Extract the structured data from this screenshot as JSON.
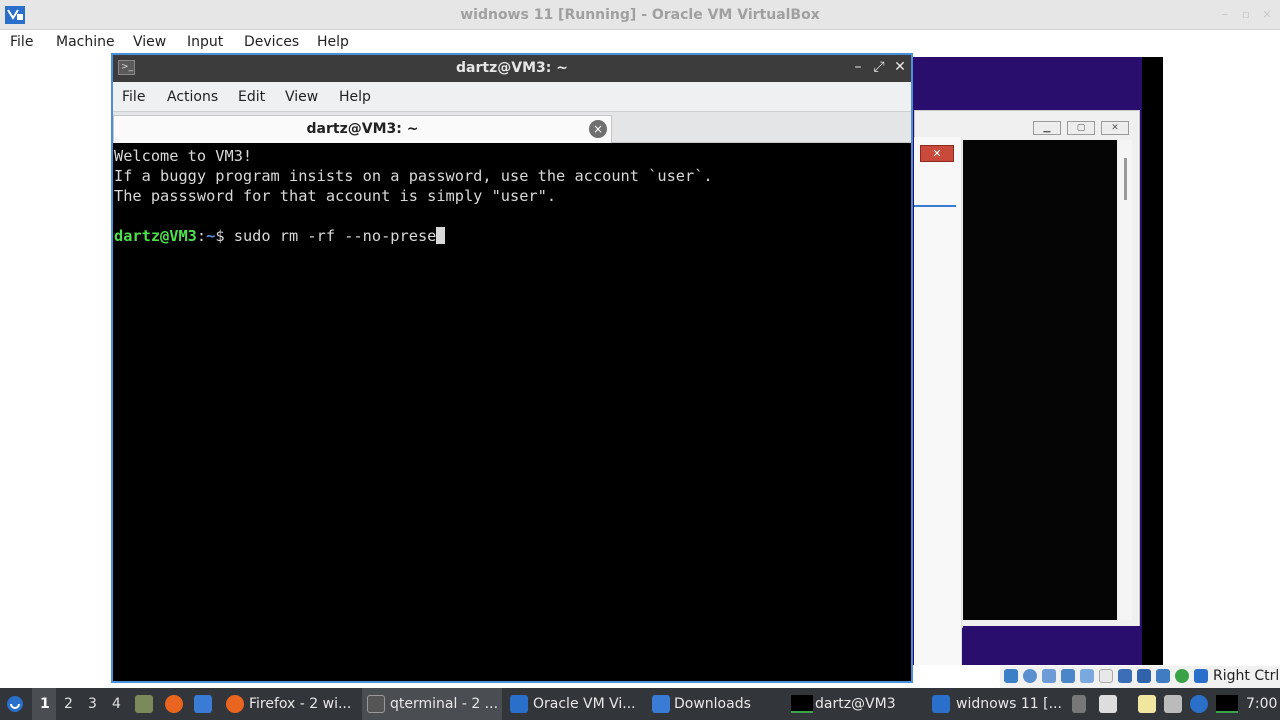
{
  "vbox": {
    "title": "widnows 11 [Running] - Oracle VM VirtualBox",
    "menu": [
      "File",
      "Machine",
      "View",
      "Input",
      "Devices",
      "Help"
    ],
    "host_key": "Right Ctrl"
  },
  "terminal": {
    "title": "dartz@VM3: ~",
    "menu": [
      "File",
      "Actions",
      "Edit",
      "View",
      "Help"
    ],
    "tab_label": "dartz@VM3: ~",
    "lines": [
      "Welcome to VM3!",
      "If a buggy program insists on a password, use the account `user`.",
      "The passsword for that account is simply \"user\"."
    ],
    "prompt_user": "dartz@VM3",
    "prompt_sep": ":",
    "prompt_path": "~",
    "prompt_symbol": "$ ",
    "command": "sudo rm -rf --no-prese"
  },
  "taskbar": {
    "workspaces": [
      "1",
      "2",
      "3",
      "4"
    ],
    "tasks": [
      {
        "label": "Firefox - 2 wi..."
      },
      {
        "label": "qterminal - 2 ..."
      },
      {
        "label": "Oracle VM Vi..."
      },
      {
        "label": "Downloads"
      },
      {
        "label": "dartz@VM3"
      },
      {
        "label": "widnows 11 [..."
      }
    ],
    "clock": "7:00"
  },
  "colors": {
    "accent": "#4a90d9",
    "prompt_user": "#4ee04e",
    "prompt_path": "#5c8fe6",
    "taskbar_bg": "#323539"
  }
}
